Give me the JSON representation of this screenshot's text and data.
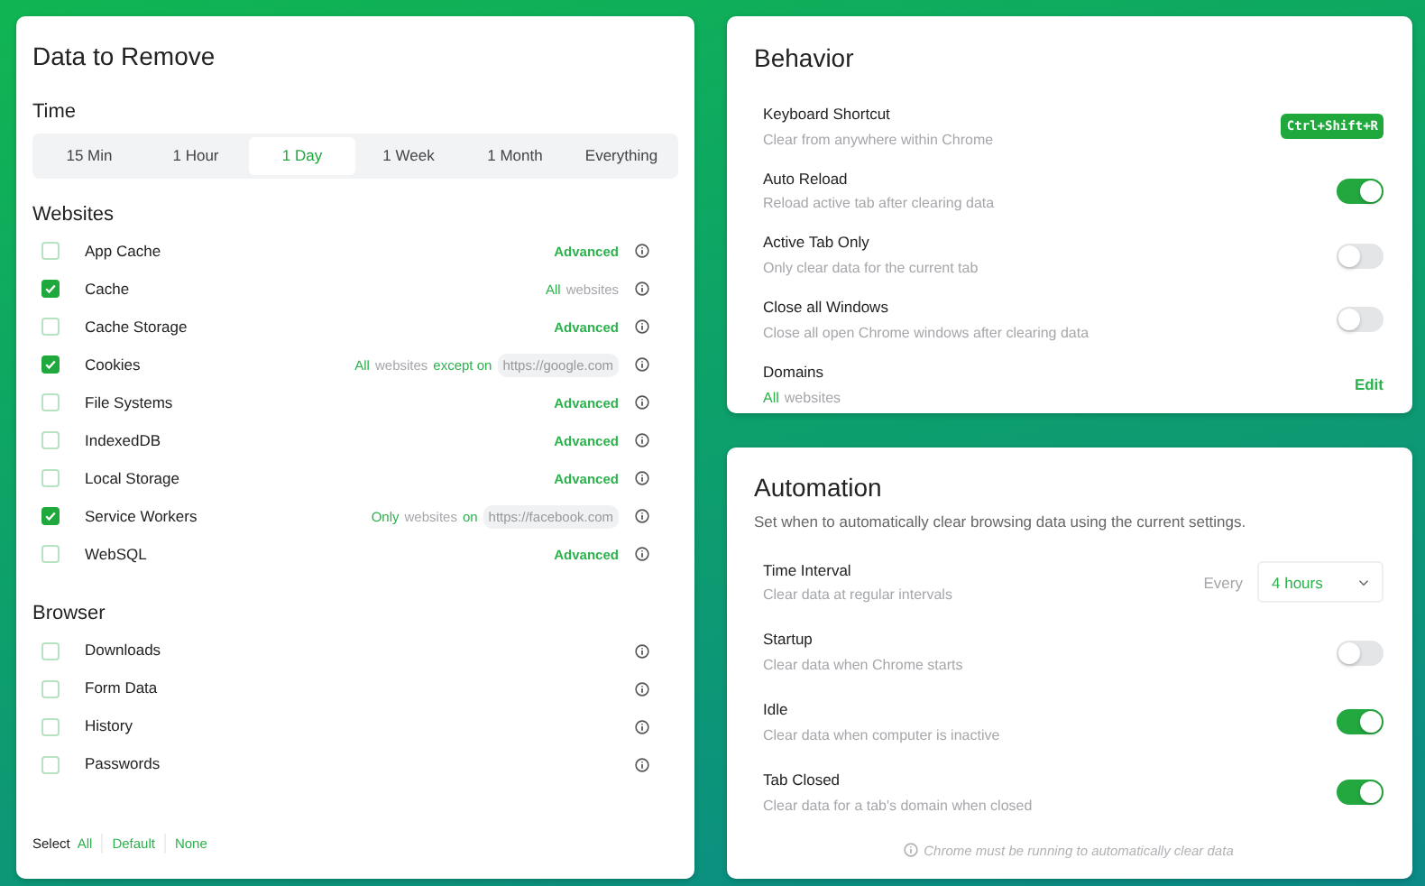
{
  "data_to_remove": {
    "title": "Data to Remove",
    "time": {
      "heading": "Time",
      "options": [
        {
          "label": "15 Min",
          "selected": false
        },
        {
          "label": "1 Hour",
          "selected": false
        },
        {
          "label": "1 Day",
          "selected": true
        },
        {
          "label": "1 Week",
          "selected": false
        },
        {
          "label": "1 Month",
          "selected": false
        },
        {
          "label": "Everything",
          "selected": false
        }
      ]
    },
    "websites": {
      "heading": "Websites",
      "items": [
        {
          "label": "App Cache",
          "checked": false,
          "note": [
            {
              "text": "Advanced",
              "kind": "link"
            }
          ]
        },
        {
          "label": "Cache",
          "checked": true,
          "note": [
            {
              "text": "All",
              "kind": "accent"
            },
            {
              "text": "websites",
              "kind": "muted"
            }
          ]
        },
        {
          "label": "Cache Storage",
          "checked": false,
          "note": [
            {
              "text": "Advanced",
              "kind": "link"
            }
          ]
        },
        {
          "label": "Cookies",
          "checked": true,
          "note": [
            {
              "text": "All",
              "kind": "accent"
            },
            {
              "text": "websites",
              "kind": "muted"
            },
            {
              "text": "except on",
              "kind": "accent"
            },
            {
              "text": "https://google.com",
              "kind": "url"
            }
          ]
        },
        {
          "label": "File Systems",
          "checked": false,
          "note": [
            {
              "text": "Advanced",
              "kind": "link"
            }
          ]
        },
        {
          "label": "IndexedDB",
          "checked": false,
          "note": [
            {
              "text": "Advanced",
              "kind": "link"
            }
          ]
        },
        {
          "label": "Local Storage",
          "checked": false,
          "note": [
            {
              "text": "Advanced",
              "kind": "link"
            }
          ]
        },
        {
          "label": "Service Workers",
          "checked": true,
          "note": [
            {
              "text": "Only",
              "kind": "accent"
            },
            {
              "text": "websites",
              "kind": "muted"
            },
            {
              "text": "on",
              "kind": "accent"
            },
            {
              "text": "https://facebook.com",
              "kind": "url"
            }
          ]
        },
        {
          "label": "WebSQL",
          "checked": false,
          "note": [
            {
              "text": "Advanced",
              "kind": "link"
            }
          ]
        }
      ]
    },
    "browser": {
      "heading": "Browser",
      "items": [
        {
          "label": "Downloads",
          "checked": false
        },
        {
          "label": "Form Data",
          "checked": false
        },
        {
          "label": "History",
          "checked": false
        },
        {
          "label": "Passwords",
          "checked": false
        }
      ]
    },
    "select": {
      "label": "Select",
      "links": [
        "All",
        "Default",
        "None"
      ]
    }
  },
  "behavior": {
    "title": "Behavior",
    "items": [
      {
        "kind": "shortcut",
        "title": "Keyboard Shortcut",
        "subtitle": [
          {
            "text": "Clear from anywhere within Chrome",
            "kind": "muted"
          }
        ],
        "value": "Ctrl+Shift+R"
      },
      {
        "kind": "toggle",
        "title": "Auto Reload",
        "subtitle": [
          {
            "text": "Reload active tab after clearing data",
            "kind": "muted"
          }
        ],
        "on": true
      },
      {
        "kind": "toggle",
        "title": "Active Tab Only",
        "subtitle": [
          {
            "text": "Only clear data for the current tab",
            "kind": "muted"
          }
        ],
        "on": false
      },
      {
        "kind": "toggle",
        "title": "Close all Windows",
        "subtitle": [
          {
            "text": "Close all open Chrome windows after clearing data",
            "kind": "muted"
          }
        ],
        "on": false
      },
      {
        "kind": "link",
        "title": "Domains",
        "subtitle": [
          {
            "text": "All",
            "kind": "accent"
          },
          {
            "text": "websites",
            "kind": "muted"
          }
        ],
        "action": "Edit"
      }
    ]
  },
  "automation": {
    "title": "Automation",
    "description": "Set when to automatically clear browsing data using the current settings.",
    "items": [
      {
        "kind": "select",
        "title": "Time Interval",
        "subtitle": [
          {
            "text": "Clear data at regular intervals",
            "kind": "muted"
          }
        ],
        "prefix": "Every",
        "value": "4 hours"
      },
      {
        "kind": "toggle",
        "title": "Startup",
        "subtitle": [
          {
            "text": "Clear data when Chrome starts",
            "kind": "muted"
          }
        ],
        "on": false
      },
      {
        "kind": "toggle",
        "title": "Idle",
        "subtitle": [
          {
            "text": "Clear data when computer is inactive",
            "kind": "muted"
          }
        ],
        "on": true
      },
      {
        "kind": "toggle",
        "title": "Tab Closed",
        "subtitle": [
          {
            "text": "Clear data for a tab's domain when closed",
            "kind": "muted"
          }
        ],
        "on": true
      }
    ],
    "footnote": "Chrome must be running to automatically clear data"
  }
}
